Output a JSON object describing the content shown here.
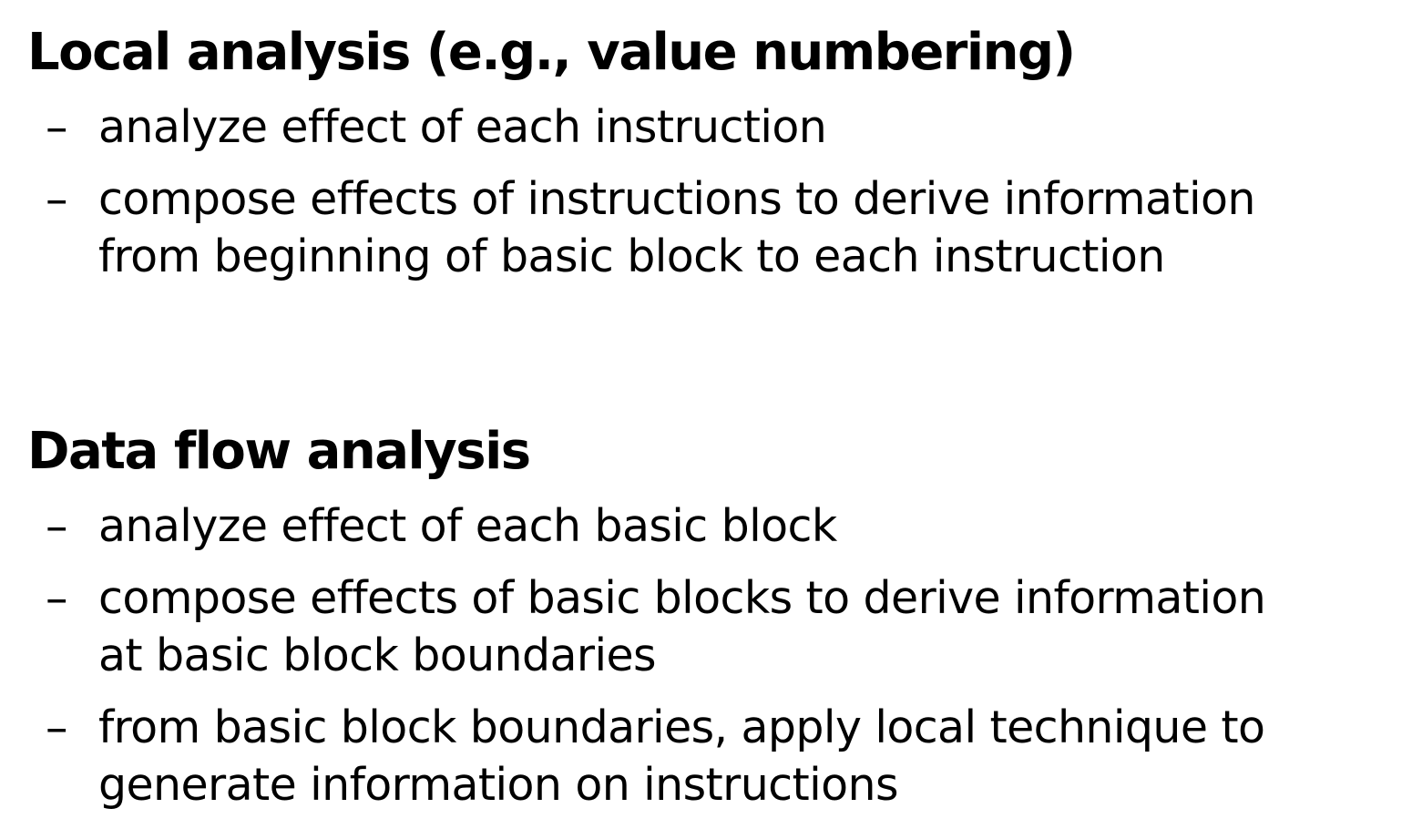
{
  "sections": [
    {
      "heading": "Local analysis (e.g., value numbering)",
      "bullets": [
        {
          "dash": "–",
          "lines": [
            "analyze effect of each instruction"
          ]
        },
        {
          "dash": "–",
          "lines": [
            "compose effects of instructions to derive information",
            "from beginning of basic block to each instruction"
          ]
        }
      ]
    },
    {
      "heading": "Data flow analysis",
      "bullets": [
        {
          "dash": "–",
          "lines": [
            "analyze effect of each basic block"
          ]
        },
        {
          "dash": "–",
          "lines": [
            "compose effects of basic blocks to derive information",
            "at basic block boundaries"
          ]
        },
        {
          "dash": "–",
          "lines": [
            "from basic block boundaries, apply local technique to",
            "generate information on instructions"
          ]
        }
      ]
    }
  ]
}
